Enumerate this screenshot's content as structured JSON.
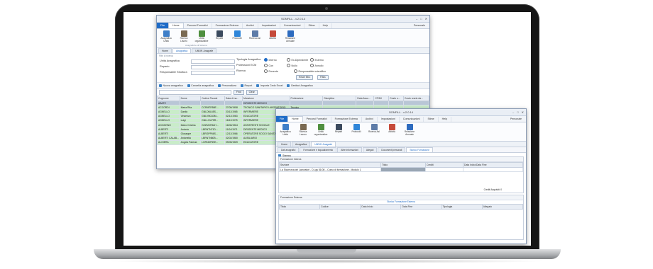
{
  "colors": {
    "accent": "#1e6bc7",
    "selected_row": "#b9c6d6",
    "green_row": "#c9ecc9"
  },
  "main_window": {
    "title": "SONFILL - v.2.0.14",
    "file_tab": "File",
    "ribbon_tabs": [
      "Home",
      "Percorsi Formativi",
      "Formazione Esterna",
      "Archivi",
      "Impostazioni",
      "Comunicazioni",
      "Stime",
      "Help"
    ],
    "user": "Personale",
    "ribbon_buttons": [
      {
        "label": "Anagrafica Unità",
        "icon": "id-card-icon",
        "color": "#3f7fc8"
      },
      {
        "label": "Ricerca Lavoro",
        "icon": "briefcase-icon",
        "color": "#7a6a52"
      },
      {
        "label": "Unità organizzative",
        "icon": "people-icon",
        "color": "#4f8f3f"
      },
      {
        "label": "Reparti",
        "icon": "org-chart-icon",
        "color": "#3b4a5e"
      },
      {
        "label": "Protocolli",
        "icon": "protocol-icon",
        "color": "#2f86d9"
      },
      {
        "label": "Ricerca Asl",
        "icon": "search-monitor-icon",
        "color": "#5e7ca8"
      },
      {
        "label": "Attività",
        "icon": "calendar-icon",
        "color": "#c64a3a"
      },
      {
        "label": "Relazione Annuale",
        "icon": "document-icon",
        "color": "#2d6bbf"
      }
    ],
    "ribbon_group": "Anagrafiche di Sistema",
    "doc_tabs": [
      "Home",
      "Anagrafica",
      "Uff/Uff. Anagrafe"
    ],
    "form": {
      "section": "Filtri di ricerca",
      "fields": [
        "Unità Anagrafica",
        "Reparto",
        "Responsabile Struttura"
      ],
      "right_fields": [
        "Tipologia Anagrafica",
        "Professioni ECM",
        "Ricerca"
      ],
      "radios_col1": [
        "Interno",
        "Con",
        "Docente"
      ],
      "radios_col2": [
        "Ex-Dipendente",
        "Nullo",
        "Responsabile scientifico"
      ],
      "radios_col3": [
        "Esterno",
        "Annullo"
      ],
      "reset_button": "Reset filtro",
      "filter_button": "Filtra"
    },
    "actions": [
      "Nuova anagrafica",
      "Cancella anagrafica",
      "Personalizza",
      "Report",
      "Importa Cedo Excel",
      "Gestisci Anagrafica"
    ],
    "search": {
      "find_label": "Find",
      "clear_label": "Clear"
    },
    "table": {
      "headers": [
        "Cognome",
        "Nome",
        "Codice Fiscale",
        "Data di na...",
        "Mansione",
        "Professione",
        "Disciplina",
        "Data Assu...",
        "CF/MI",
        "Costo o...",
        "Costo orario da..."
      ],
      "rows": [
        {
          "cells": [
            "ABATE",
            "",
            "",
            "",
            "DIRIGENTE MEDICO",
            "",
            "",
            "",
            "",
            "",
            ""
          ],
          "kind": "sel"
        },
        {
          "cells": [
            "ACCORDI",
            "Maria Rita",
            "CCRMTR58E...",
            "27/05/1958",
            "TECNICO SANITARIO LABORATORIO",
            "Tecnico",
            "",
            "",
            "",
            "",
            ""
          ],
          "kind": "green"
        },
        {
          "cells": [
            "AGNELLO",
            "Danilo",
            "GNLDNL65S...",
            "20/11/1965",
            "INFERMIERE",
            "",
            "",
            "",
            "",
            "",
            ""
          ],
          "kind": "green"
        },
        {
          "cells": [
            "AGNELLO",
            "Vincenzo",
            "GNLVNC63M...",
            "02/11/1963",
            "EDUCATORE",
            "",
            "",
            "",
            "",
            "",
            ""
          ],
          "kind": "green"
        },
        {
          "cells": [
            "AGNELLO",
            "Luigi",
            "GNLLGU75R...",
            "16/11/1975",
            "INFERMIERE",
            "",
            "",
            "",
            "",
            "",
            ""
          ],
          "kind": "green"
        },
        {
          "cells": [
            "AGOZZINO",
            "Mario Cristina",
            "GZZMCR64H...",
            "16/06/1964",
            "ASSISTENTE SOCIALE",
            "Infermiere",
            "",
            "",
            "",
            "",
            ""
          ],
          "kind": "green"
        },
        {
          "cells": [
            "ALBERTI",
            "Antonio",
            "LBRNTN71D...",
            "11/04/1971",
            "DIRIGENTE MEDICO",
            "Medico",
            "",
            "",
            "",
            "",
            ""
          ],
          "kind": "green"
        },
        {
          "cells": [
            "ALBERTI",
            "Giuseppe",
            "LBRGPP66S...",
            "12/11/1966",
            "OPERATORE SOCIO SANITARIO",
            "Medico",
            "",
            "",
            "",
            "",
            ""
          ],
          "kind": "green"
        },
        {
          "cells": [
            "ALBERTI CALAB...",
            "Antonella",
            "LBRNTN80B...",
            "02/02/1980",
            "AUSILIARIO",
            "",
            "",
            "",
            "",
            "",
            ""
          ],
          "kind": "green"
        },
        {
          "cells": [
            "ALGIERA",
            "Angela Patrizia",
            "LGRNGP69E...",
            "09/05/1969",
            "EDUCATORE",
            "",
            "",
            "",
            "",
            "",
            ""
          ],
          "kind": "green"
        }
      ]
    }
  },
  "second_window": {
    "title": "SONFILL - v.2.0.14",
    "file_tab": "File",
    "ribbon_tabs": [
      "Home",
      "Percorsi Formativi",
      "Formazione Esterna",
      "Archivi",
      "Impostazioni",
      "Comunicazioni",
      "Stime",
      "Help"
    ],
    "user": "Personale",
    "doc_tabs": [
      "Home",
      "Anagrafica",
      "Uff/Uff. Anagrafe"
    ],
    "inner_tabs": [
      "Dati anagrafici",
      "Formazione e Inquadramento",
      "Altre informazioni",
      "Allegati",
      "Documenti personali",
      "Storico Formazione"
    ],
    "active_inner": "Storico Formazione",
    "stampa": "Stampa",
    "panel1": {
      "title": "Formazione Interna",
      "col": [
        "Sezione",
        "Titolo",
        "Crediti",
        "Data Inizio/Data Fine"
      ],
      "row": "La Sicurezza dei Lavoratori - D.Lgs 81/08 – Corso di formazione - Modulo 1",
      "footer": "Crediti Acquisiti: 0"
    },
    "panel2": {
      "title": "Formazione Esterna",
      "subtitle": "Storico Formazione Esterna",
      "cols": [
        "Titolo",
        "Codice",
        "Data Inizio",
        "Data Fine",
        "Tipologia",
        "Allegato"
      ]
    }
  }
}
